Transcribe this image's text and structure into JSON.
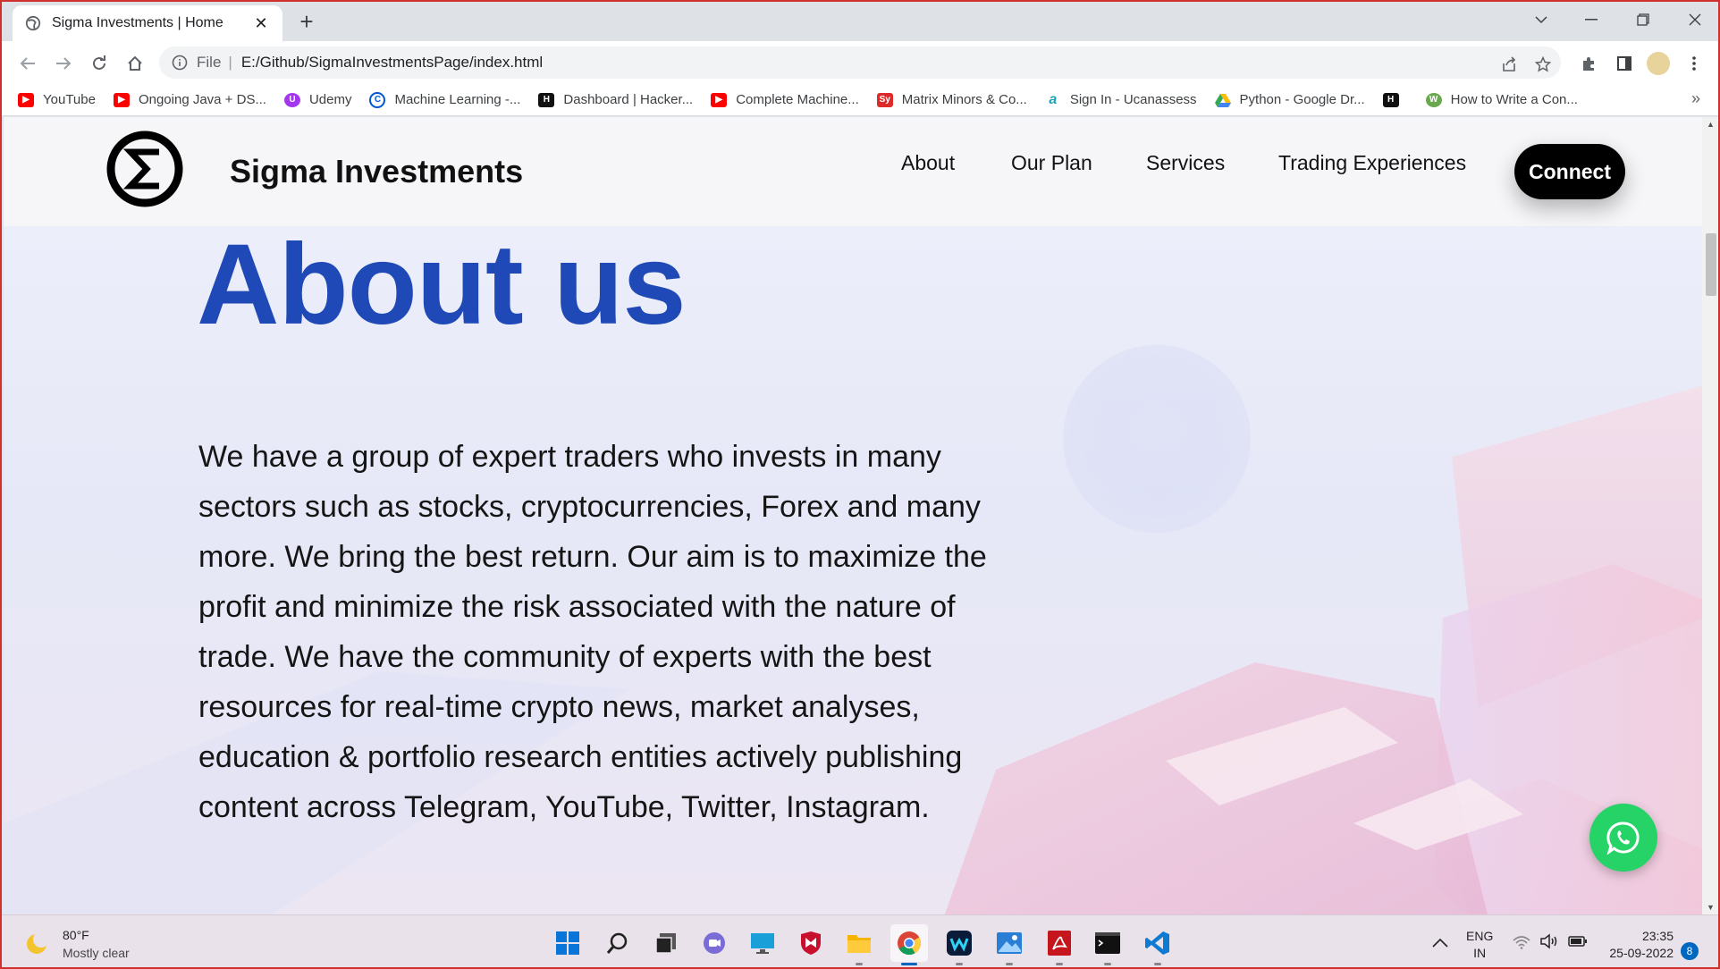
{
  "browser": {
    "tab_title": "Sigma Investments | Home",
    "url_scheme": "File",
    "url_path": "E:/Github/SigmaInvestmentsPage/index.html"
  },
  "bookmarks": [
    {
      "label": "YouTube",
      "icon": "youtube-icon",
      "color": "#ff0000"
    },
    {
      "label": "Ongoing Java + DS...",
      "icon": "youtube-icon",
      "color": "#ff0000"
    },
    {
      "label": "Udemy",
      "icon": "udemy-icon",
      "color": "#a435f0"
    },
    {
      "label": "Machine Learning -...",
      "icon": "coursera-icon",
      "color": "#0056d2"
    },
    {
      "label": "Dashboard | Hacker...",
      "icon": "hackerrank-icon",
      "color": "#111111"
    },
    {
      "label": "Complete Machine...",
      "icon": "youtube-icon",
      "color": "#ff0000"
    },
    {
      "label": "Matrix Minors & Co...",
      "icon": "symbolab-icon",
      "color": "#dd2a2a"
    },
    {
      "label": "Sign In - Ucanassess",
      "icon": "ucanassess-icon",
      "color": "#1aa3b8"
    },
    {
      "label": "Python - Google Dr...",
      "icon": "google-drive-icon",
      "color": "#34a853"
    },
    {
      "label": "",
      "icon": "hackerrank-icon",
      "color": "#111111"
    },
    {
      "label": "How to Write a Con...",
      "icon": "site-icon",
      "color": "#6aa84f"
    }
  ],
  "site": {
    "brand": "Sigma Investments",
    "nav": [
      "About",
      "Our Plan",
      "Services",
      "Trading Experiences"
    ],
    "cta": "Connect",
    "heading": "About us",
    "paragraph": "We have a group of expert traders who invests in many sectors such as stocks, cryptocurrencies, Forex and many more. We bring the best return. Our aim is to maximize the profit and minimize the risk associated with the nature of trade. We have the community of experts with the best resources for real-time crypto news, market analyses, education & portfolio research entities actively publishing content across Telegram, YouTube, Twitter, Instagram.",
    "accent_color": "#1f49b6",
    "whatsapp_color": "#25d366"
  },
  "taskbar": {
    "weather_temp": "80°F",
    "weather_desc": "Mostly clear",
    "lang_top": "ENG",
    "lang_bottom": "IN",
    "time": "23:35",
    "date": "25-09-2022",
    "notifications": "8"
  }
}
